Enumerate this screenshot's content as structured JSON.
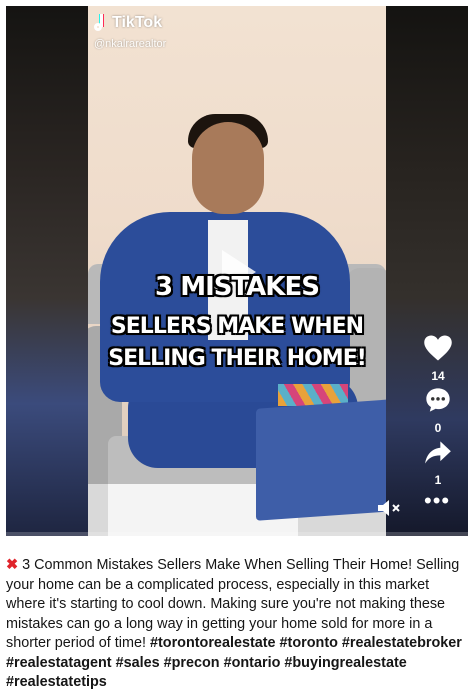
{
  "watermark": {
    "brand": "TikTok",
    "handle": "@nkalrarealtor",
    "icon": "tiktok-logo-icon"
  },
  "overlay": {
    "line1": "3 MISTAKES",
    "line2": "SELLERS MAKE WHEN",
    "line3": "SELLING THEIR HOME!"
  },
  "actions": {
    "likes": "14",
    "comments": "0",
    "shares": "1",
    "like_icon": "heart-icon",
    "comment_icon": "comment-bubble-icon",
    "share_icon": "share-arrow-icon",
    "more_icon": "more-dots-icon",
    "mute_icon": "speaker-muted-icon"
  },
  "player": {
    "progress_fraction": 0.0
  },
  "caption": {
    "lead_icon": "red-x-icon",
    "text": "3 Common Mistakes Sellers Make When Selling Their Home! Selling your home can be a complicated process, especially in this market where it's starting to cool down. Making sure you're not making these mistakes can go a long way in getting your home sold for more in a shorter period of time!",
    "hashtags": [
      "#torontorealestate",
      "#toronto",
      "#realestatebroker",
      "#realestatagent",
      "#sales",
      "#precon",
      "#ontario",
      "#buyingrealestate",
      "#realestatetips"
    ]
  },
  "colors": {
    "accent": "#fe2c55",
    "x_mark": "#e0242b",
    "jacket": "#2c4d9a"
  }
}
